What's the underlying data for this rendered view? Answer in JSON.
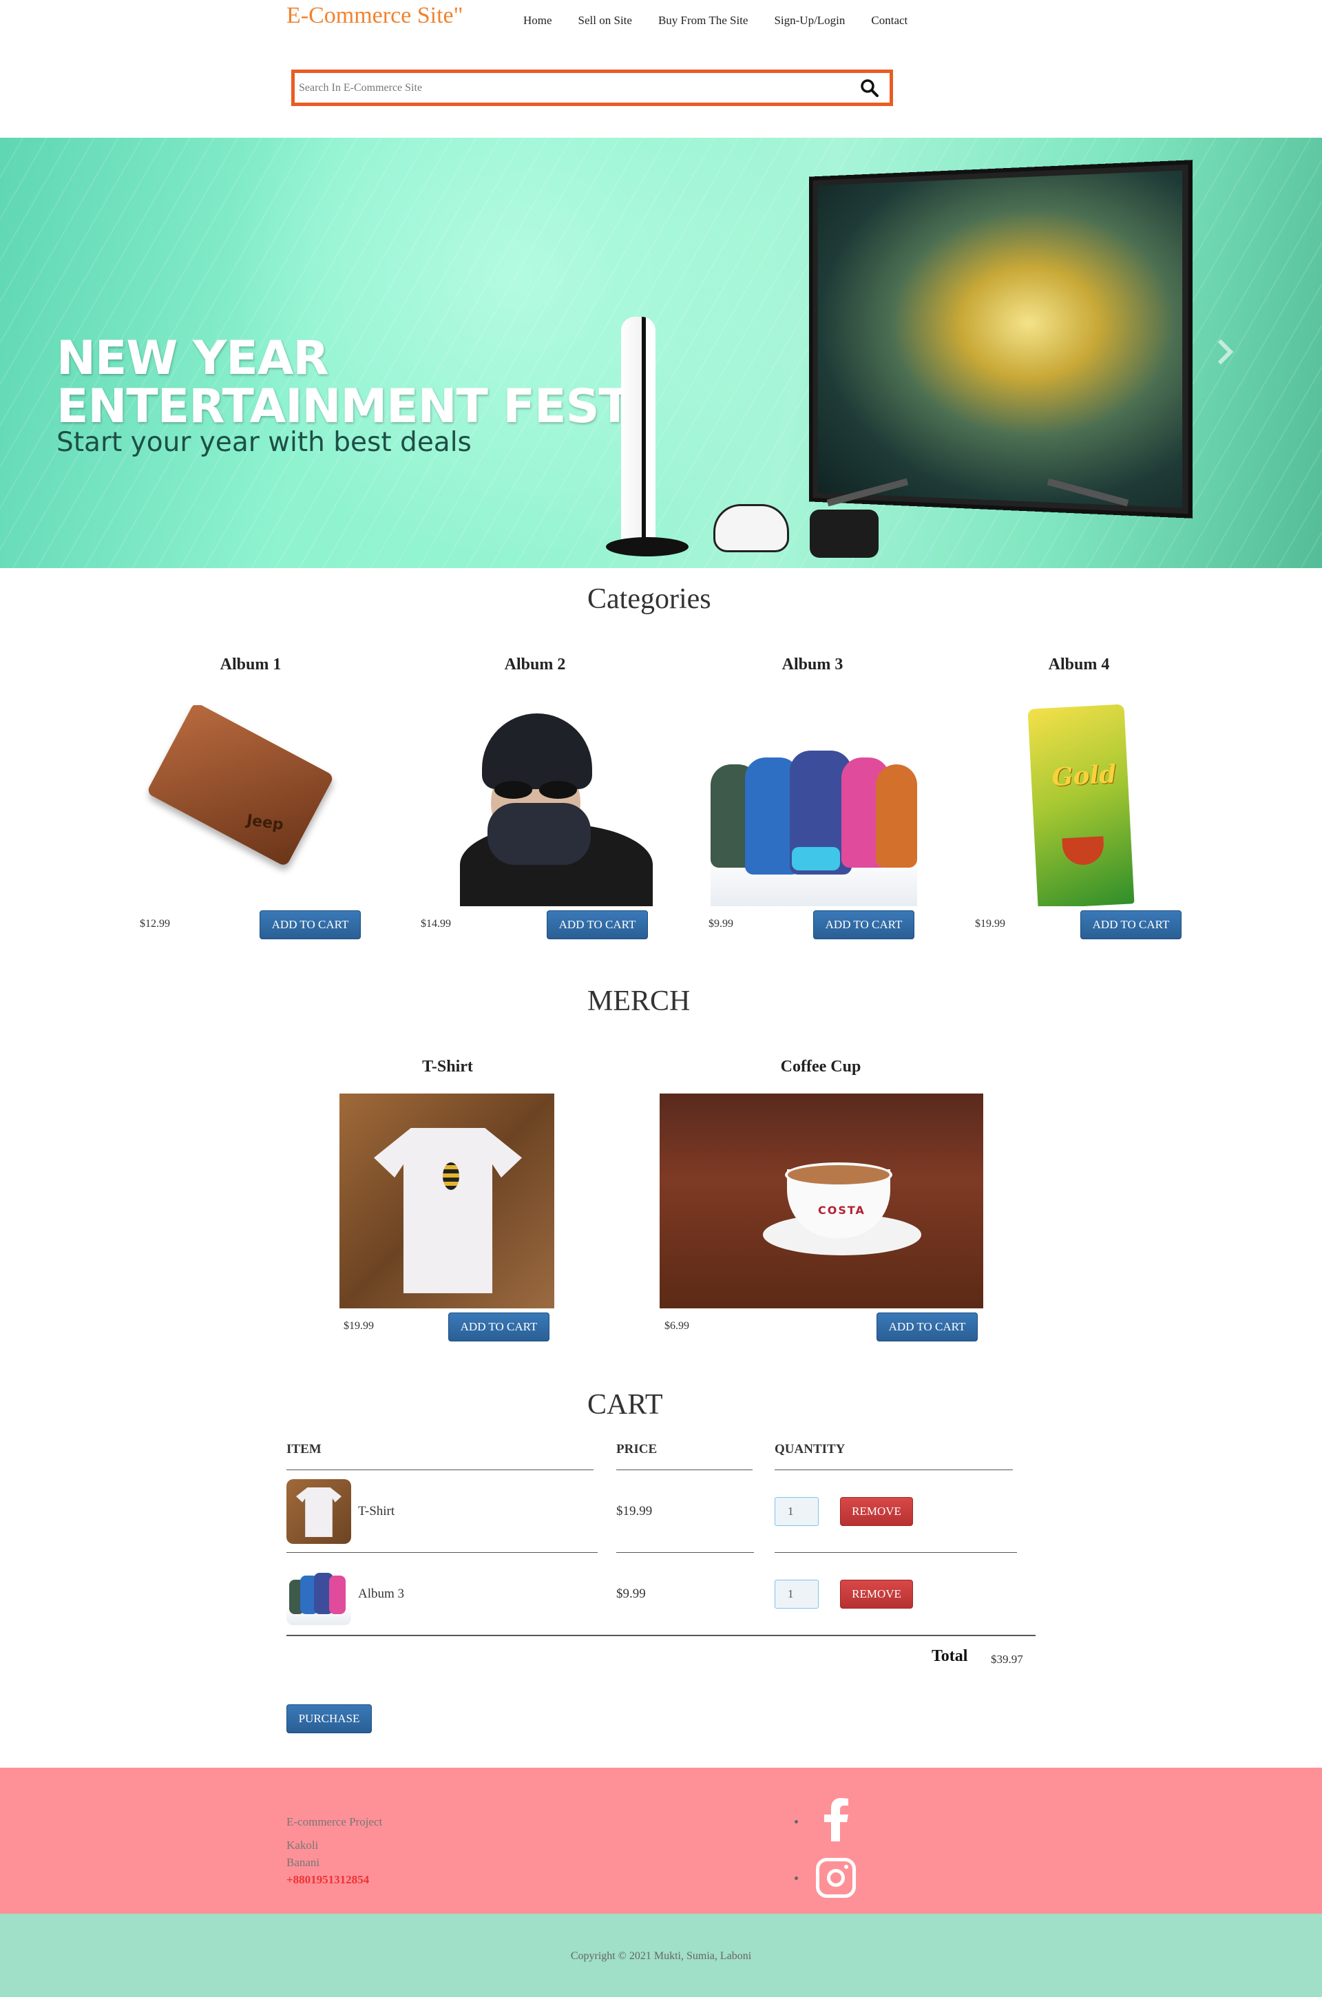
{
  "header": {
    "brand": "E-Commerce Site\"",
    "nav": [
      "Home",
      "Sell on Site",
      "Buy From The Site",
      "Sign-Up/Login",
      "Contact"
    ]
  },
  "search": {
    "placeholder": "Search In E-Commerce Site",
    "icon": "search-icon"
  },
  "hero": {
    "headline_line1": "NEW YEAR",
    "headline_line2": "ENTERTAINMENT FEST",
    "subline": "Start your year with best deals",
    "slide_count": 6,
    "active_slide": 4
  },
  "categories": {
    "title": "Categories",
    "items": [
      {
        "title": "Album 1",
        "price": "$12.99",
        "button": "ADD TO CART"
      },
      {
        "title": "Album 2",
        "price": "$14.99",
        "button": "ADD TO CART"
      },
      {
        "title": "Album 3",
        "price": "$9.99",
        "button": "ADD TO CART"
      },
      {
        "title": "Album 4",
        "price": "$19.99",
        "button": "ADD TO CART"
      }
    ]
  },
  "merch": {
    "title": "MERCH",
    "items": [
      {
        "title": "T-Shirt",
        "price": "$19.99",
        "button": "ADD TO CART"
      },
      {
        "title": "Coffee Cup",
        "price": "$6.99",
        "button": "ADD TO CART"
      }
    ]
  },
  "cart": {
    "title": "CART",
    "headers": {
      "item": "ITEM",
      "price": "PRICE",
      "quantity": "QUANTITY"
    },
    "rows": [
      {
        "name": "T-Shirt",
        "price": "$19.99",
        "quantity": "1",
        "remove": "REMOVE"
      },
      {
        "name": "Album 3",
        "price": "$9.99",
        "quantity": "1",
        "remove": "REMOVE"
      }
    ],
    "total_label": "Total",
    "total_value": "$39.97",
    "purchase": "PURCHASE"
  },
  "footer": {
    "project": "E-commerce Project",
    "address_line1": "Kakoli",
    "address_line2": "Banani",
    "phone": "+8801951312854",
    "social": [
      "facebook-icon",
      "instagram-icon"
    ],
    "copyright": "Copyright © 2021 Mukti, Sumia, Laboni"
  },
  "colors": {
    "brand": "#f0832f",
    "search_border": "#e95c23",
    "button_blue": "#2a5f95",
    "remove_red": "#b73131",
    "footer_pink": "#fe9197",
    "copyright_mint": "#a0dfc8"
  }
}
